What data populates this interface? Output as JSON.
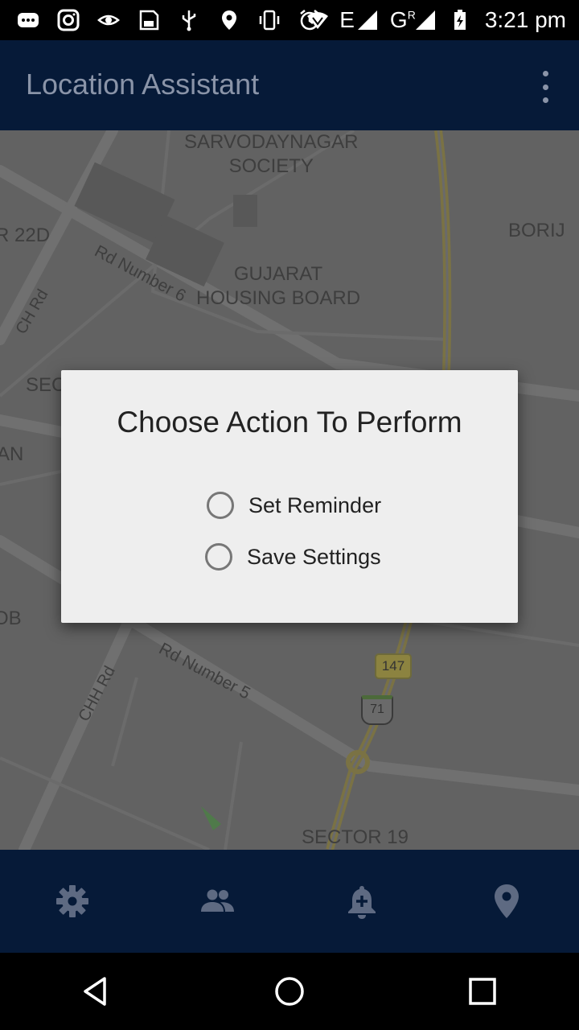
{
  "status_bar": {
    "time": "3:21 pm",
    "network_1": "E",
    "network_2": "G",
    "network_2_super": "R"
  },
  "app_bar": {
    "title": "Location Assistant"
  },
  "map": {
    "labels": {
      "sarvodaynagar": "SARVODAYNAGAR\nSOCIETY",
      "borij": "BORIJ",
      "gujarat": "GUJARAT\nHOUSING BOARD",
      "r22d": "R 22D",
      "rd6": "Rd Number 6",
      "chrd": "CH Rd",
      "sec": "SEC",
      "an": "AN",
      "ob": "OB",
      "rd5": "Rd Number 5",
      "chhrd": "CHH Rd",
      "shield147": "147",
      "shield71": "71",
      "sector19": "SECTOR 19"
    }
  },
  "dialog": {
    "title": "Choose Action To Perform",
    "options": [
      {
        "label": "Set Reminder"
      },
      {
        "label": "Save Settings"
      }
    ]
  },
  "bottom_nav": {
    "items": [
      "settings-icon",
      "people-icon",
      "add-alarm-icon",
      "location-pin-icon"
    ]
  },
  "colors": {
    "app_bar": "#061a38",
    "icon_tint": "#8a94a8",
    "dialog_bg": "#eeeeee",
    "map_bg": "#626262"
  }
}
